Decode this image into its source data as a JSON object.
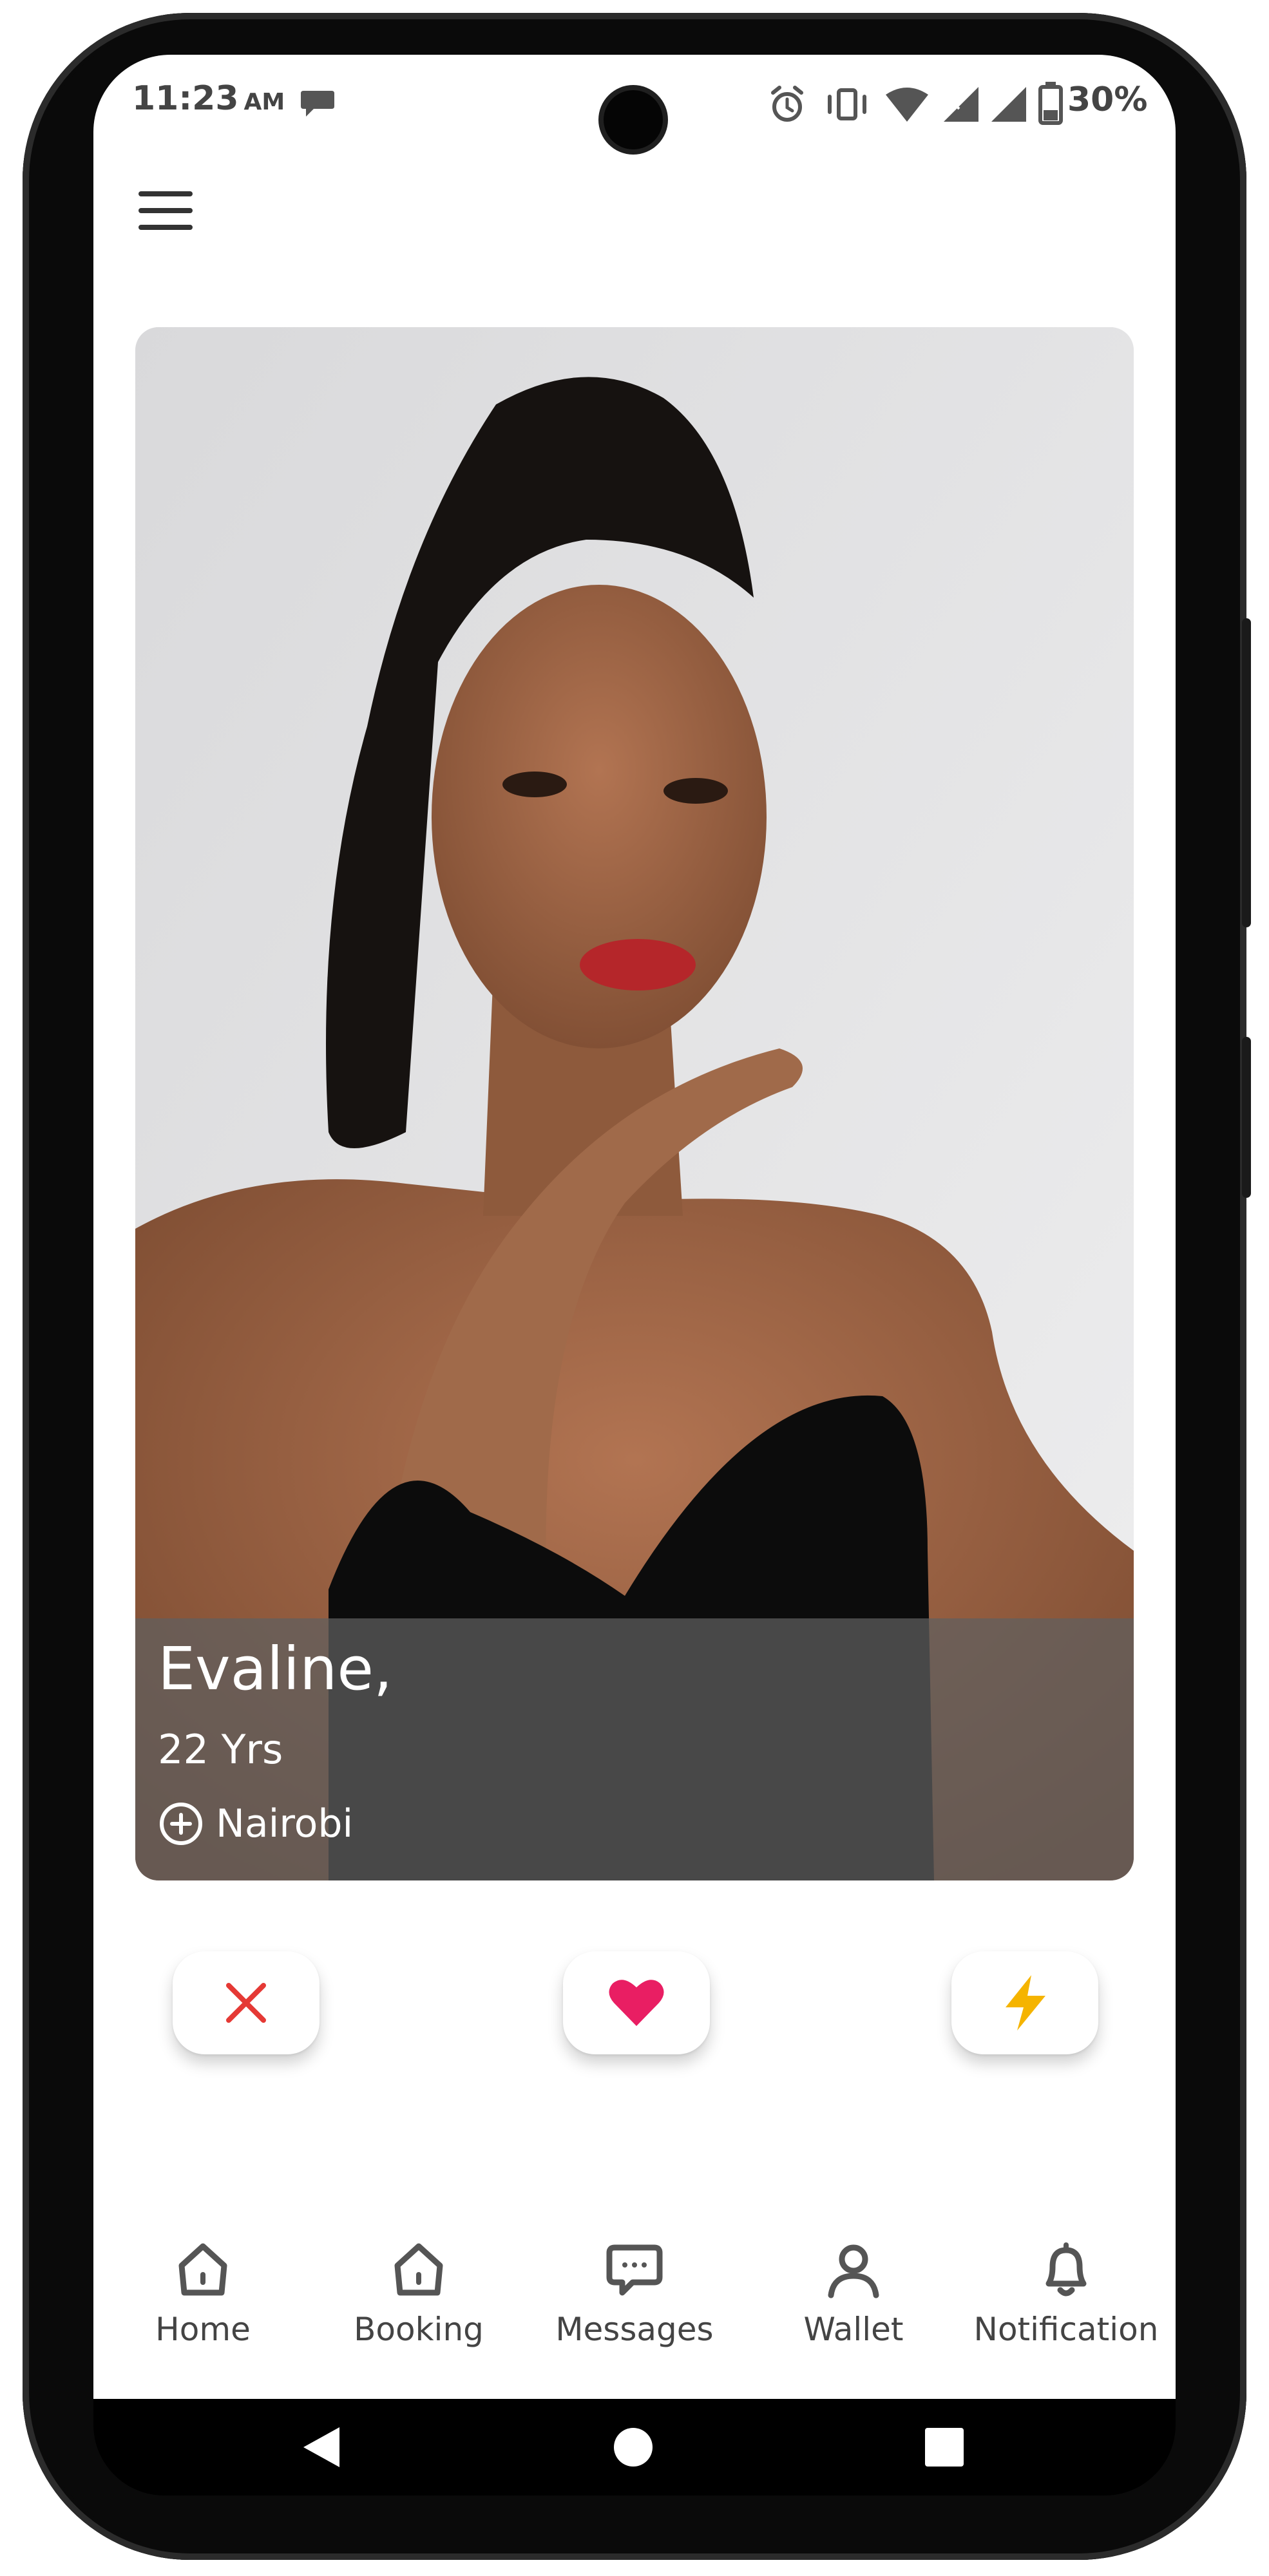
{
  "status_bar": {
    "time": "11:23",
    "am_pm": "AM",
    "battery": "30%",
    "icons": [
      "chat-bubble-icon",
      "alarm-icon",
      "vibrate-icon",
      "wifi-icon",
      "signal-icon",
      "signal-icon",
      "battery-icon"
    ]
  },
  "header": {
    "menu_icon": "hamburger-menu-icon"
  },
  "profile": {
    "name": "Evaline,",
    "age": "22 Yrs",
    "location": "Nairobi",
    "location_icon": "location-plus-icon"
  },
  "actions": [
    {
      "name": "dislike",
      "icon": "close-icon",
      "color": "#e53935"
    },
    {
      "name": "like",
      "icon": "heart-icon",
      "color": "#e91e63"
    },
    {
      "name": "boost",
      "icon": "lightning-icon",
      "color": "#f5b400"
    }
  ],
  "bottom_nav": {
    "items": [
      {
        "label": "Home",
        "icon": "home-icon"
      },
      {
        "label": "Booking",
        "icon": "home-icon"
      },
      {
        "label": "Messages",
        "icon": "chat-icon"
      },
      {
        "label": "Wallet",
        "icon": "user-icon"
      },
      {
        "label": "Notification",
        "icon": "bell-icon"
      }
    ]
  },
  "system_nav": {
    "icons": [
      "back-icon",
      "home-circle-icon",
      "recents-icon"
    ]
  }
}
